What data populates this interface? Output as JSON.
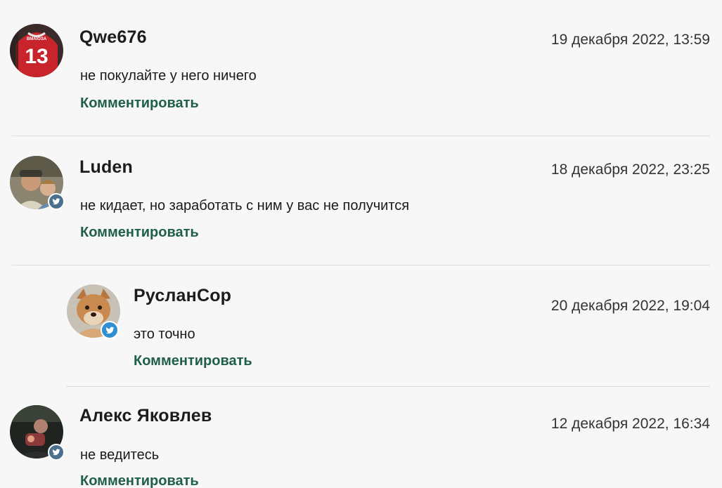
{
  "comments": [
    {
      "author": "Qwe676",
      "date": "19 декабря 2022, 13:59",
      "text": "не покулайте у него ничего",
      "reply_label": "Комментировать",
      "avatar_text": {
        "top": "BMAIOЗА",
        "number": "13"
      },
      "social": null
    },
    {
      "author": "Luden",
      "date": "18 декабря 2022, 23:25",
      "text": "не кидает, но заработать с ним у вас не получится",
      "reply_label": "Комментировать",
      "social": "twitter"
    },
    {
      "author": "РусланСор",
      "date": "20 декабря 2022, 19:04",
      "text": "это точно",
      "reply_label": "Комментировать",
      "social": "twitter",
      "nested": true
    },
    {
      "author": "Алекс Яковлев",
      "date": "12 декабря 2022, 16:34",
      "text": "не ведитесь",
      "reply_label": "Комментировать",
      "social": "twitter"
    }
  ],
  "colors": {
    "accent": "#1f5f4a",
    "twitter_badge": "#4a6f8f",
    "twitter_badge_alt": "#2f8fd0",
    "divider": "#dcdcdc",
    "background": "#f7f7f7"
  },
  "icons": [
    "user-avatar",
    "twitter-icon"
  ]
}
